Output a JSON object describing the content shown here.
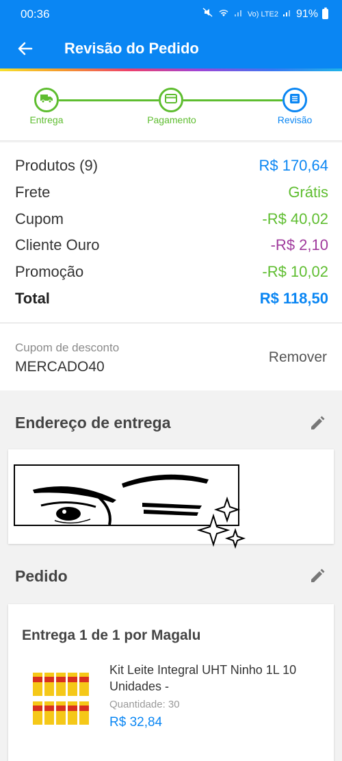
{
  "status_bar": {
    "time": "00:36",
    "network_label": "Vo) LTE2",
    "battery": "91%"
  },
  "header": {
    "title": "Revisão do Pedido"
  },
  "stepper": {
    "steps": [
      {
        "label": "Entrega"
      },
      {
        "label": "Pagamento"
      },
      {
        "label": "Revisão"
      }
    ]
  },
  "summary": {
    "rows": [
      {
        "label": "Produtos (9)",
        "value": "R$ 170,64"
      },
      {
        "label": "Frete",
        "value": "Grátis"
      },
      {
        "label": "Cupom",
        "value": "-R$ 40,02"
      },
      {
        "label": "Cliente Ouro",
        "value": "-R$ 2,10"
      },
      {
        "label": "Promoção",
        "value": "-R$ 10,02"
      },
      {
        "label": "Total",
        "value": "R$ 118,50"
      }
    ]
  },
  "coupon": {
    "caption": "Cupom de desconto",
    "code": "MERCADO40",
    "remove_label": "Remover"
  },
  "address": {
    "title": "Endereço de entrega"
  },
  "order": {
    "title": "Pedido",
    "delivery_label": "Entrega 1 de 1 por Magalu",
    "item": {
      "name": "Kit Leite Integral UHT Ninho 1L 10 Unidades -",
      "quantity_text": "Quantidade:  30",
      "price": "R$ 32,84"
    }
  },
  "colors": {
    "primary": "#0a86f3",
    "green": "#5ebd2f",
    "purple": "#a03a9c"
  }
}
